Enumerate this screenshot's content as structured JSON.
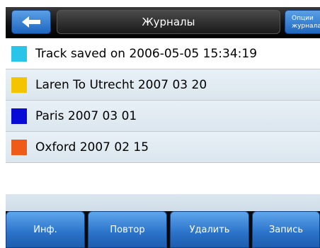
{
  "header": {
    "back_icon": "back-arrow-icon",
    "title": "Журналы",
    "options_line1": "Опции",
    "options_line2": "журнала"
  },
  "list": {
    "items": [
      {
        "label": "Track saved on 2006-05-05 15:34:19",
        "color": "#29c5e8"
      },
      {
        "label": "Laren To Utrecht 2007 03 20",
        "color": "#f5c400"
      },
      {
        "label": "Paris 2007 03 01",
        "color": "#0a0ad6"
      },
      {
        "label": "Oxford 2007 02 15",
        "color": "#ee5a18"
      }
    ]
  },
  "toolbar": {
    "info_label": "Инф.",
    "repeat_label": "Повтор",
    "delete_label": "Удалить",
    "record_label": "Запись"
  },
  "colors": {
    "button_blue": "#2a72c8",
    "header_dark": "#101010",
    "row_alt": "#dbe6ee"
  }
}
